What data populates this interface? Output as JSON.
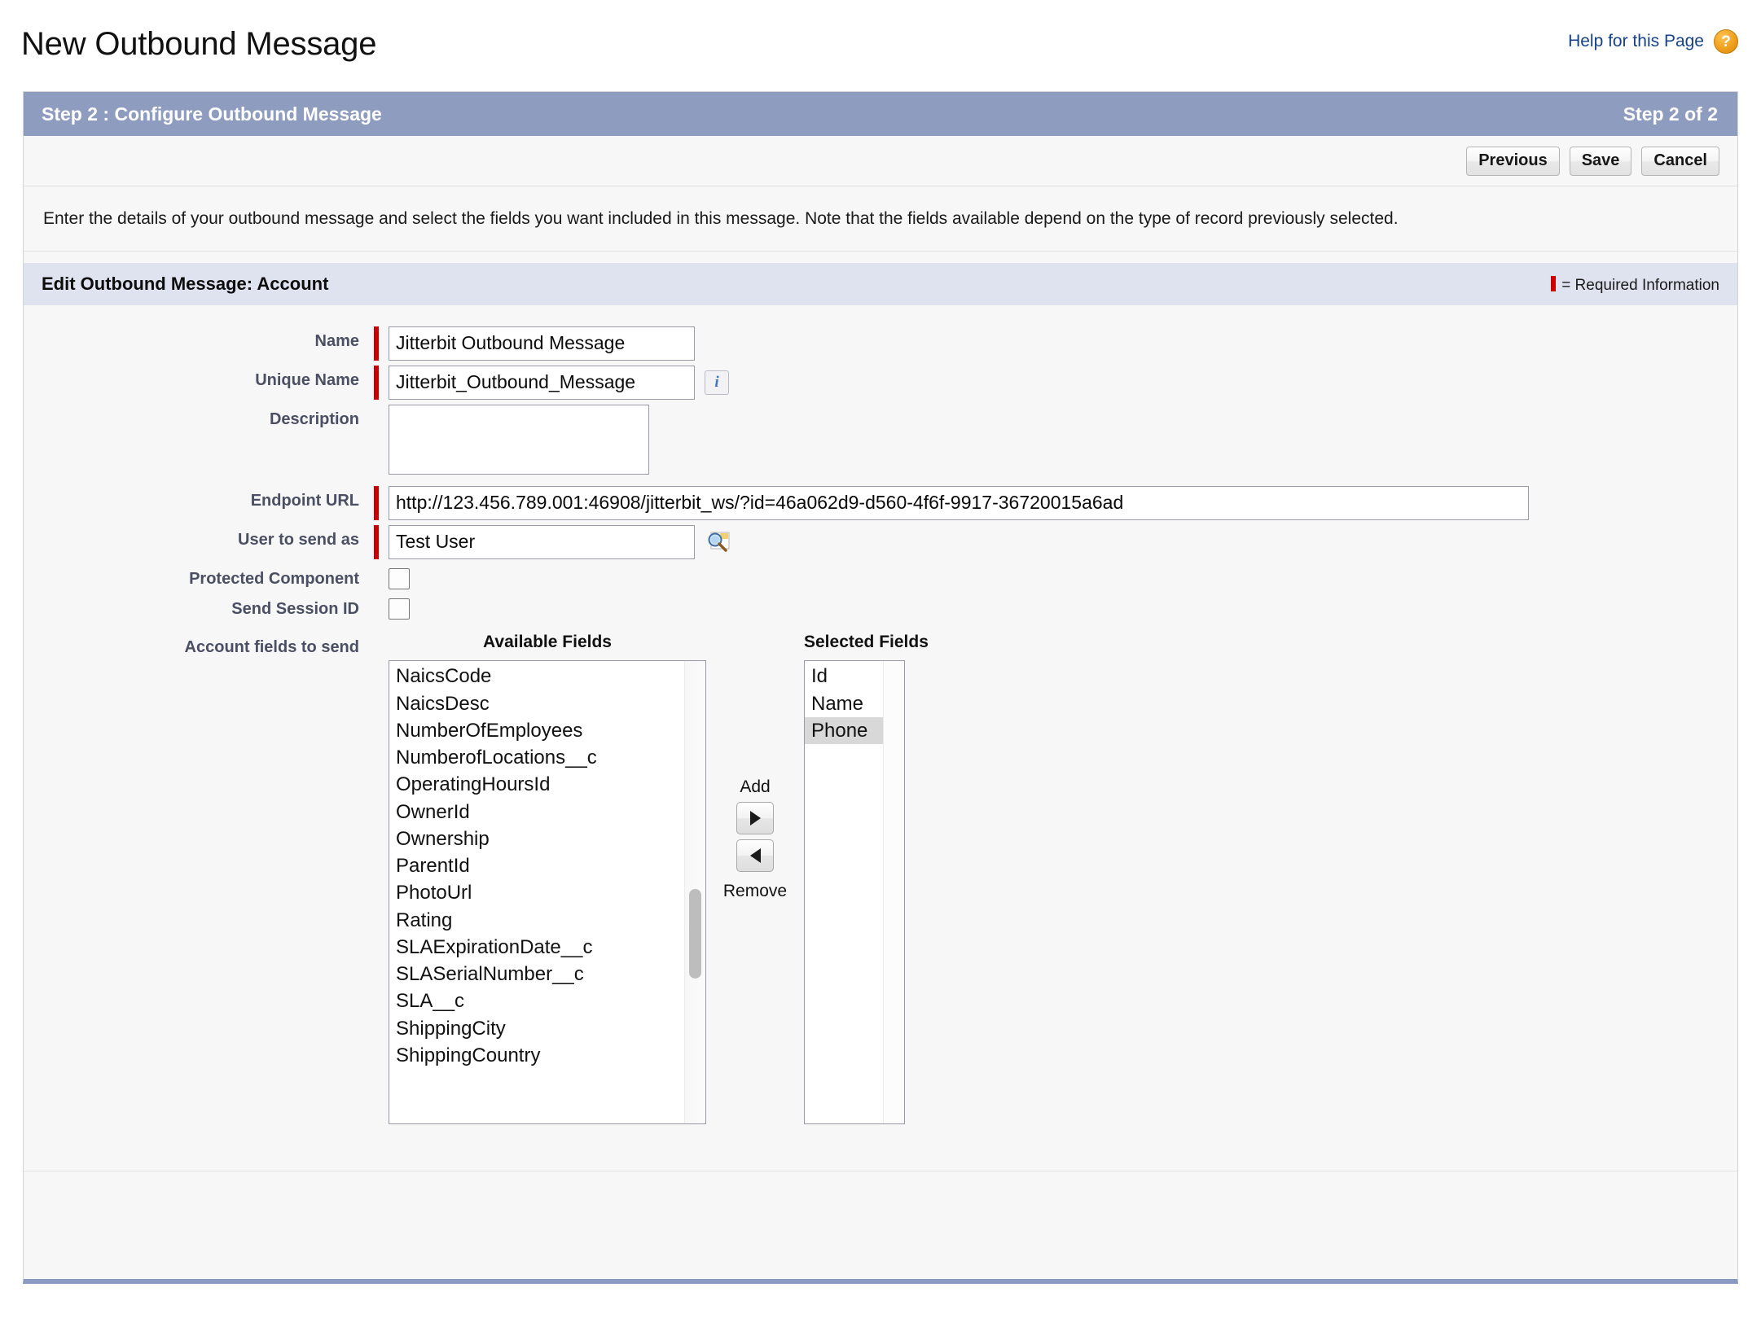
{
  "page": {
    "title": "New Outbound Message",
    "help_link": "Help for this Page",
    "help_icon": "question-mark-icon"
  },
  "step_bar": {
    "title": "Step 2 : Configure Outbound Message",
    "progress": "Step 2 of 2"
  },
  "toolbar": {
    "previous_label": "Previous",
    "save_label": "Save",
    "cancel_label": "Cancel"
  },
  "instruction": "Enter the details of your outbound message and select the fields you want included in this message. Note that the fields available depend on the type of record previously selected.",
  "section": {
    "title": "Edit Outbound Message: Account",
    "required_legend": "= Required Information"
  },
  "form": {
    "name": {
      "label": "Name",
      "value": "Jitterbit Outbound Message",
      "required": true
    },
    "unique_name": {
      "label": "Unique Name",
      "value": "Jitterbit_Outbound_Message",
      "required": true,
      "info_icon": "info-icon"
    },
    "description": {
      "label": "Description",
      "value": "",
      "placeholder": ""
    },
    "endpoint_url": {
      "label": "Endpoint URL",
      "value": "http://123.456.789.001:46908/jitterbit_ws/?id=46a062d9-d560-4f6f-9917-36720015a6ad",
      "required": true
    },
    "user_to_send_as": {
      "label": "User to send as",
      "value": "Test User",
      "required": true,
      "lookup_icon": "magnifier-lookup-icon"
    },
    "protected_component": {
      "label": "Protected Component",
      "checked": false
    },
    "send_session_id": {
      "label": "Send Session ID",
      "checked": false
    },
    "fields_to_send": {
      "label": "Account fields to send"
    }
  },
  "dual_list": {
    "available_label": "Available Fields",
    "selected_label": "Selected Fields",
    "add_label": "Add",
    "remove_label": "Remove",
    "add_icon": "arrow-right-icon",
    "remove_icon": "arrow-left-icon",
    "available_fields": [
      "NaicsCode",
      "NaicsDesc",
      "NumberOfEmployees",
      "NumberofLocations__c",
      "OperatingHoursId",
      "OwnerId",
      "Ownership",
      "ParentId",
      "PhotoUrl",
      "Rating",
      "SLAExpirationDate__c",
      "SLASerialNumber__c",
      "SLA__c",
      "ShippingCity",
      "ShippingCountry"
    ],
    "selected_fields": [
      "Id",
      "Name",
      "Phone"
    ],
    "highlighted_selected": "Phone"
  },
  "colors": {
    "step_bar": "#8e9cc0",
    "section_band": "#dfe3ef",
    "required_marker": "#cc0000",
    "link": "#15428b",
    "label_text": "#4a4f63",
    "panel_bottom": "#8a9ac2"
  }
}
